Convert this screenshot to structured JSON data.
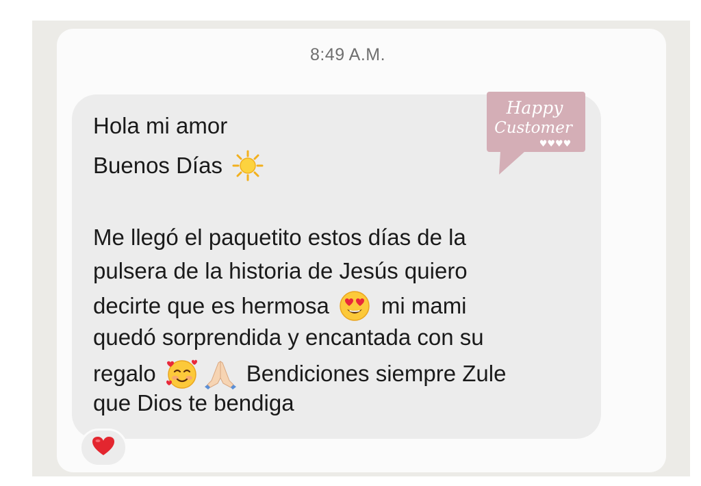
{
  "conversation": {
    "timestamp": "8:49 A.M."
  },
  "message": {
    "lines": [
      "Hola mi amor",
      "Buenos Días",
      "Me llegó el paquetito estos días de la",
      "pulsera de la historia de Jesús quiero",
      "decirte que es hermosa",
      "mi mami",
      "quedó sorprendida y encantada con su",
      "regalo",
      "Bendiciones siempre Zule",
      "que Dios te bendiga"
    ],
    "emojis": {
      "sun": "sun-emoji",
      "heart_eyes": "heart-eyes-emoji",
      "smiling_hearts": "smiling-face-with-hearts-emoji",
      "praying_hands": "folded-hands-emoji"
    },
    "reaction": "red-heart"
  },
  "sticker": {
    "line1": "Happy",
    "line2": "Customer",
    "hearts": "♥♥♥♥",
    "color": "#d4aeb6"
  },
  "colors": {
    "bubble": "#ececec",
    "panel": "#fbfbfb",
    "frame": "#ecebe7",
    "text": "#1a1a1a",
    "timestamp": "#6f6f6f"
  }
}
